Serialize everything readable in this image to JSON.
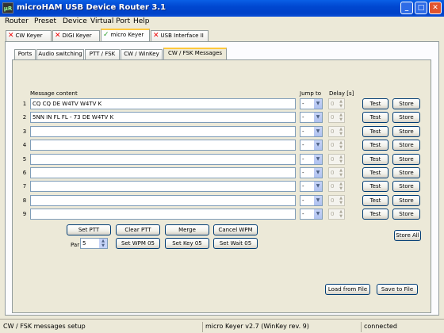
{
  "window": {
    "title": "microHAM USB Device Router 3.1",
    "icon_text": "μR",
    "minimize_glyph": "_",
    "maximize_glyph": "□",
    "close_glyph": "✕"
  },
  "menu": [
    "Router",
    "Preset",
    "Device",
    "Virtual Port",
    "Help"
  ],
  "device_tabs": [
    {
      "label": "CW Keyer",
      "status": "disconnected",
      "status_glyph": "✕"
    },
    {
      "label": "DIGI Keyer",
      "status": "disconnected",
      "status_glyph": "✕"
    },
    {
      "label": "micro Keyer",
      "status": "connected",
      "status_glyph": "✓",
      "selected": true
    },
    {
      "label": "USB Interface II",
      "status": "disconnected",
      "status_glyph": "✕"
    }
  ],
  "sub_tabs": [
    {
      "label": "Ports"
    },
    {
      "label": "Audio switching"
    },
    {
      "label": "PTT / FSK"
    },
    {
      "label": "CW / WinKey"
    },
    {
      "label": "CW / FSK Messages",
      "selected": true
    }
  ],
  "messages_panel": {
    "header_content": "Message content",
    "header_jump": "Jump to",
    "header_delay": "Delay [s]",
    "rows": [
      {
        "n": "1",
        "content": "CQ CQ DE W4TV W4TV K",
        "jump": "-",
        "delay": "0",
        "test": "Test",
        "store": "Store"
      },
      {
        "n": "2",
        "content": "5NN IN FL FL - 73 DE W4TV K",
        "jump": "-",
        "delay": "0",
        "test": "Test",
        "store": "Store"
      },
      {
        "n": "3",
        "content": "",
        "jump": "-",
        "delay": "0",
        "test": "Test",
        "store": "Store"
      },
      {
        "n": "4",
        "content": "",
        "jump": "-",
        "delay": "0",
        "test": "Test",
        "store": "Store"
      },
      {
        "n": "5",
        "content": "",
        "jump": "-",
        "delay": "0",
        "test": "Test",
        "store": "Store"
      },
      {
        "n": "6",
        "content": "",
        "jump": "-",
        "delay": "0",
        "test": "Test",
        "store": "Store"
      },
      {
        "n": "7",
        "content": "",
        "jump": "-",
        "delay": "0",
        "test": "Test",
        "store": "Store"
      },
      {
        "n": "8",
        "content": "",
        "jump": "-",
        "delay": "0",
        "test": "Test",
        "store": "Store"
      },
      {
        "n": "9",
        "content": "",
        "jump": "-",
        "delay": "0",
        "test": "Test",
        "store": "Store"
      }
    ],
    "buttons": {
      "set_ptt": "Set PTT",
      "clear_ptt": "Clear PTT",
      "merge": "Merge",
      "cancel_wpm": "Cancel WPM",
      "set_wpm": "Set WPM 05",
      "set_key": "Set Key 05",
      "set_wait": "Set Wait 05",
      "store_all": "Store All",
      "load_file": "Load from File",
      "save_file": "Save to File"
    },
    "par_label": "Par",
    "par_value": "5"
  },
  "status_bar": {
    "left": "CW / FSK messages setup",
    "middle": "micro Keyer v2.7 (WinKey rev. 9)",
    "right": "connected"
  },
  "colors": {
    "titlebar": "#0A5FE6",
    "window_bg": "#ECE9D8",
    "tab_highlight": "#FFC83C",
    "disconnected_red": "#E00000",
    "connected_green": "#2CA02C",
    "button_border": "#003C74"
  }
}
